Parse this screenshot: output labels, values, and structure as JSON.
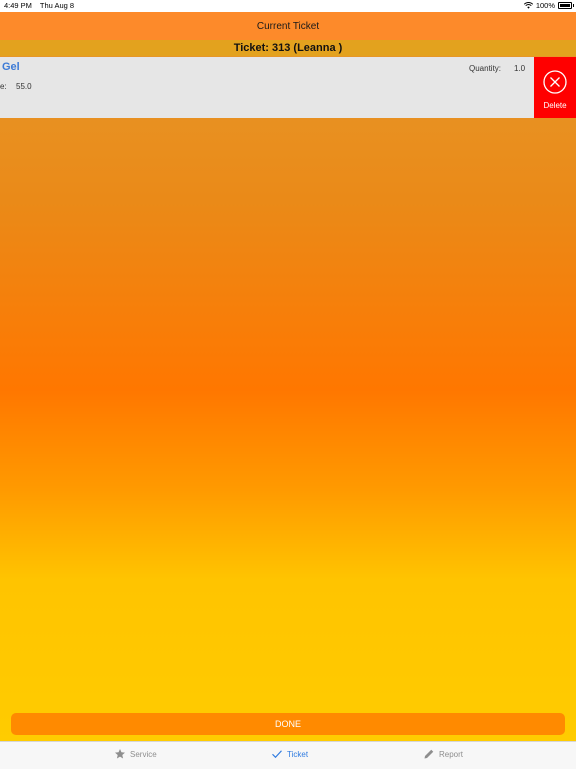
{
  "status_bar": {
    "time": "4:49 PM",
    "date": "Thu Aug 8",
    "battery": "100%",
    "icons": [
      "wifi-icon",
      "battery-icon"
    ]
  },
  "nav": {
    "title": "Current Ticket"
  },
  "ticket_header": {
    "text": "Ticket: 313 (Leanna )"
  },
  "item": {
    "name": "Gel",
    "quantity_label": "Quantity:",
    "quantity_value": "1.0",
    "price_label": "e:",
    "price_value": "55.0"
  },
  "delete_action": {
    "label": "Delete",
    "icon": "close-circle-icon",
    "color": "#ff0000"
  },
  "done_button": {
    "label": "DONE"
  },
  "tabs": [
    {
      "label": "Service",
      "icon": "star-icon",
      "active": false
    },
    {
      "label": "Ticket",
      "icon": "checkmark-icon",
      "active": true
    },
    {
      "label": "Report",
      "icon": "pencil-icon",
      "active": false
    }
  ],
  "colors": {
    "nav": "#fd8a2a",
    "ticket_bar": "#e3a21e",
    "accent_blue": "#2f7be0",
    "done": "#ff8a00"
  }
}
